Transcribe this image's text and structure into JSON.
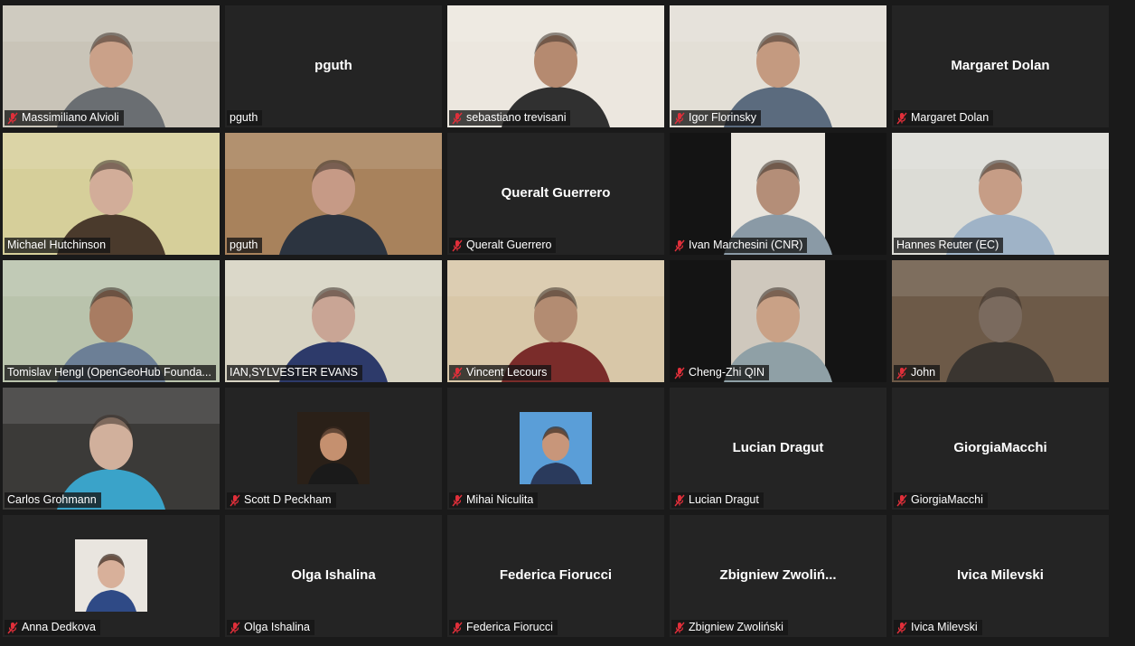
{
  "meeting": {
    "participants": [
      {
        "id": "p1",
        "tag": "Massimiliano Alvioli",
        "muted": true,
        "kind": "video",
        "bg": "#c9c4b8",
        "skin": "#caa189",
        "shirt": "#6a6e72"
      },
      {
        "id": "p2",
        "tag": "pguth",
        "muted": false,
        "kind": "name",
        "center": "pguth"
      },
      {
        "id": "p3",
        "tag": "sebastiano trevisani",
        "muted": true,
        "kind": "video",
        "bg": "#ece7df",
        "skin": "#b58a70",
        "shirt": "#303030"
      },
      {
        "id": "p4",
        "tag": "Igor Florinsky",
        "muted": true,
        "kind": "video",
        "bg": "#e3dfd6",
        "skin": "#c49a80",
        "shirt": "#5b6b7e"
      },
      {
        "id": "p5",
        "tag": "Margaret Dolan",
        "muted": true,
        "kind": "name",
        "center": "Margaret Dolan"
      },
      {
        "id": "p6",
        "tag": "Michael Hutchinson",
        "muted": false,
        "kind": "video",
        "bg": "#d6cf9a",
        "skin": "#d2ad99",
        "shirt": "#4a3a2c"
      },
      {
        "id": "p7",
        "tag": "pguth",
        "muted": false,
        "kind": "video",
        "bg": "#a8825c",
        "skin": "#c69a86",
        "shirt": "#2c3440"
      },
      {
        "id": "p8",
        "tag": "Queralt Guerrero",
        "muted": true,
        "kind": "name",
        "center": "Queralt Guerrero"
      },
      {
        "id": "p9",
        "tag": "Ivan Marchesini (CNR)",
        "muted": true,
        "kind": "video",
        "bg": "#e8e4dc",
        "skin": "#b48e78",
        "shirt": "#8a9aa6",
        "narrow": true
      },
      {
        "id": "p10",
        "tag": "Hannes Reuter (EC)",
        "muted": false,
        "kind": "video",
        "bg": "#dcdcd6",
        "skin": "#c69d86",
        "shirt": "#9fb3c7",
        "active": true
      },
      {
        "id": "p11",
        "tag": "Tomislav Hengl (OpenGeoHub Founda...",
        "muted": false,
        "kind": "video",
        "bg": "#b9c3ac",
        "skin": "#a87c62",
        "shirt": "#6c7f96"
      },
      {
        "id": "p12",
        "tag": "IAN,SYLVESTER EVANS",
        "muted": false,
        "kind": "video",
        "bg": "#d7d3c2",
        "skin": "#c9a595",
        "shirt": "#2d3a6a"
      },
      {
        "id": "p13",
        "tag": "Vincent Lecours",
        "muted": true,
        "kind": "video",
        "bg": "#d8c7a8",
        "skin": "#b38c72",
        "shirt": "#7a2c2a"
      },
      {
        "id": "p14",
        "tag": "Cheng-Zhi QIN",
        "muted": true,
        "kind": "video",
        "bg": "#cfc8bd",
        "skin": "#c9a186",
        "shirt": "#8fa0a6",
        "narrow": true
      },
      {
        "id": "p15",
        "tag": "John",
        "muted": true,
        "kind": "video",
        "bg": "#6d5a48",
        "skin": "#7a6a5e",
        "shirt": "#3a3530"
      },
      {
        "id": "p16",
        "tag": "Carlos Grohmann",
        "muted": false,
        "kind": "video",
        "bg": "#3b3a38",
        "skin": "#d1b09c",
        "shirt": "#3aa3c9"
      },
      {
        "id": "p17",
        "tag": "Scott D Peckham",
        "muted": true,
        "kind": "avatar",
        "abg": "#2a2018",
        "skin": "#c5906f",
        "shirt": "#1a1a1a"
      },
      {
        "id": "p18",
        "tag": "Mihai Niculita",
        "muted": true,
        "kind": "avatar",
        "abg": "#5a9ed8",
        "skin": "#c8967a",
        "shirt": "#2a3a5c"
      },
      {
        "id": "p19",
        "tag": "Lucian Dragut",
        "muted": true,
        "kind": "name",
        "center": "Lucian Dragut"
      },
      {
        "id": "p20",
        "tag": "GiorgiaMacchi",
        "muted": true,
        "kind": "name",
        "center": "GiorgiaMacchi"
      },
      {
        "id": "p21",
        "tag": "Anna Dedkova",
        "muted": true,
        "kind": "avatar",
        "abg": "#e9e5df",
        "skin": "#d8b09a",
        "shirt": "#2f4a86"
      },
      {
        "id": "p22",
        "tag": "Olga Ishalina",
        "muted": true,
        "kind": "name",
        "center": "Olga Ishalina"
      },
      {
        "id": "p23",
        "tag": "Federica Fiorucci",
        "muted": true,
        "kind": "name",
        "center": "Federica Fiorucci"
      },
      {
        "id": "p24",
        "tag": "Zbigniew Zwoliński",
        "muted": true,
        "kind": "name",
        "center": "Zbigniew  Zwoliń..."
      },
      {
        "id": "p25",
        "tag": "Ivica Milevski",
        "muted": true,
        "kind": "name",
        "center": "Ivica Milevski"
      }
    ],
    "colors": {
      "mute": "#e02f3a",
      "active_border": "#c5e56b",
      "tile_bg": "#242424"
    },
    "icons": {
      "mute": "microphone-muted-icon"
    }
  }
}
